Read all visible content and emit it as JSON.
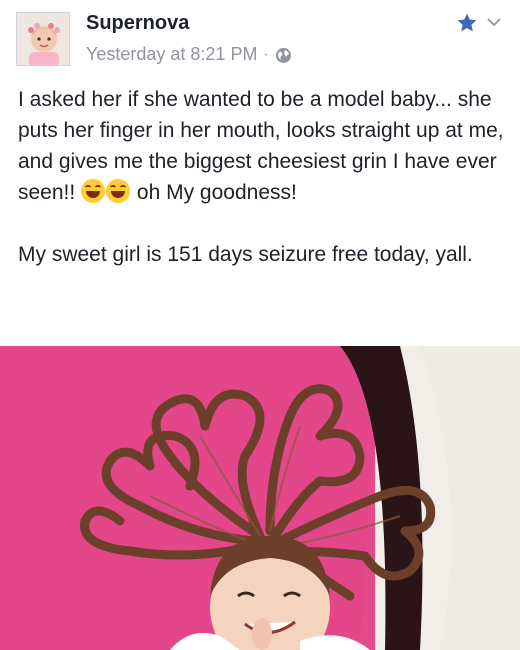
{
  "post": {
    "author": "Supernova",
    "timestamp": "Yesterday at 8:21 PM",
    "separator": "·",
    "privacy_icon": "globe-icon",
    "star_icon": "star-icon",
    "menu_icon": "chevron-down-icon",
    "text": {
      "line1": "I asked her if she wanted to be a model baby... she puts her finger in her mouth, looks straight up at me, and gives me the biggest cheesiest grin I have ever seen!!",
      "line1_after": "oh My goodness!",
      "line2": "My sweet girl is 151 days seizure free today, yall."
    },
    "emoji": "face-with-tears-of-joy",
    "photo": "baby-with-heart-shaped-hair"
  },
  "colors": {
    "name": "#1d2129",
    "meta": "#90949c",
    "star": "#4267b2",
    "blanket": "#e44b8a"
  }
}
